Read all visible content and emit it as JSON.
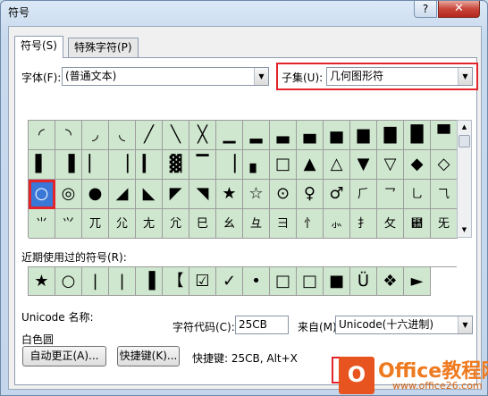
{
  "window": {
    "title": "符号",
    "help": "?",
    "close": "✕"
  },
  "tabs": [
    "符号(S)",
    "特殊字符(P)"
  ],
  "font": {
    "label": "字体(F):",
    "value": "(普通文本)"
  },
  "subset": {
    "label": "子集(U):",
    "value": "几何图形符"
  },
  "symbols": [
    "◜",
    "◝",
    "◞",
    "◟",
    "╱",
    "╲",
    "╳",
    "▁",
    "▂",
    "▃",
    "▄",
    "▅",
    "▆",
    "▇",
    "█",
    "▀",
    "▌",
    "▐",
    "▏",
    "▕",
    "▎",
    "▓",
    "▔",
    "▕",
    "▖",
    "□",
    "▲",
    "△",
    "▼",
    "▽",
    "◆",
    "◇",
    "○",
    "◎",
    "●",
    "◢",
    "◣",
    "◤",
    "◥",
    "★",
    "☆",
    "⊙",
    "♀",
    "♂",
    "⺁",
    "⺂",
    "⺃",
    "⺄",
    "⺌",
    "⺍",
    "⺎",
    "⺏",
    "⺐",
    "⺑",
    "⺒",
    "⺓",
    "⺔",
    "⺕",
    "⺖",
    "⺗",
    "⺘",
    "⺙",
    "⺚",
    "⺛"
  ],
  "recent": {
    "label": "近期使用过的符号(R):",
    "items": [
      "★",
      "○",
      "|",
      "|",
      "▐",
      "【",
      "☑",
      "✓",
      "•",
      "□",
      "□",
      "■",
      "Ü",
      "❖",
      "►"
    ]
  },
  "unicode": {
    "label": "Unicode 名称:",
    "name": "白色圆"
  },
  "charcode": {
    "label": "字符代码(C):",
    "value": "25CB"
  },
  "from": {
    "label": "来自(M):",
    "value": "Unicode(十六进制)"
  },
  "buttons": {
    "autocorrect": "自动更正(A)...",
    "shortcut": "快捷键(K)..."
  },
  "shortcut_text": "快捷键: 25CB, Alt+X",
  "watermark": {
    "brand": "Office教程网",
    "url": "www.office26.com"
  }
}
